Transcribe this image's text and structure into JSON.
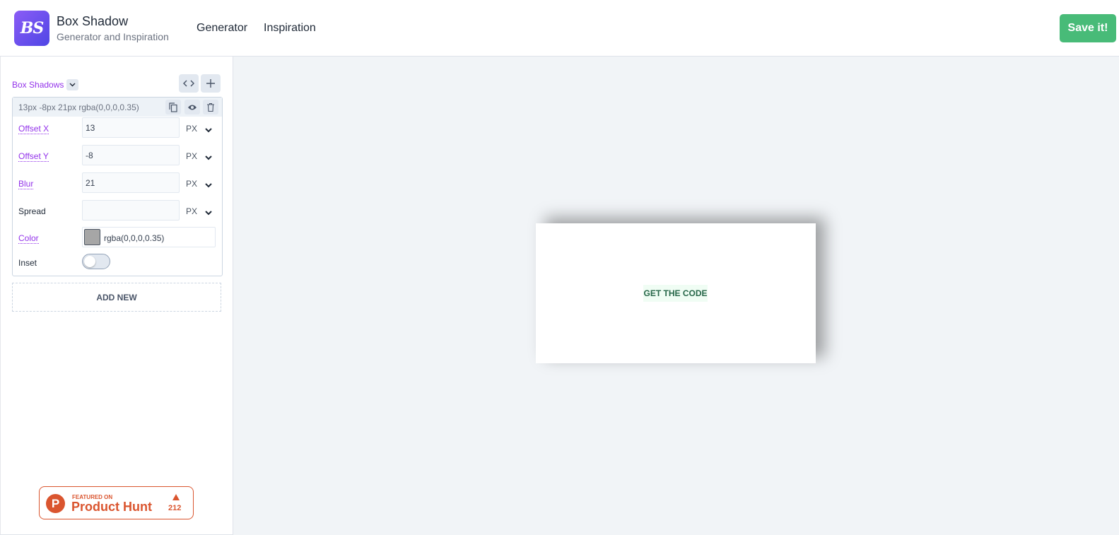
{
  "header": {
    "logo_text": "BS",
    "title": "Box Shadow",
    "subtitle": "Generator and Inspiration",
    "nav": [
      "Generator",
      "Inspiration"
    ],
    "save_label": "Save it!"
  },
  "sidebar": {
    "section_label": "Box Shadows",
    "shadow": {
      "summary": "13px -8px 21px rgba(0,0,0,0.35)",
      "rows": [
        {
          "label": "Offset X",
          "value": "13",
          "unit": "PX"
        },
        {
          "label": "Offset Y",
          "value": "-8",
          "unit": "PX"
        },
        {
          "label": "Blur",
          "value": "21",
          "unit": "PX"
        },
        {
          "label": "Spread",
          "value": "",
          "unit": "PX"
        }
      ],
      "color_label": "Color",
      "color_value": "rgba(0,0,0,0.35)",
      "inset_label": "Inset",
      "inset_on": false
    },
    "add_new_label": "ADD NEW",
    "product_hunt": {
      "featured": "FEATURED ON",
      "name": "Product Hunt",
      "count": "212"
    }
  },
  "canvas": {
    "button_label": "GET THE CODE"
  },
  "colors": {
    "accent": "#9333ea",
    "save": "#48bb78",
    "product_hunt": "#da552f",
    "canvas_bg": "#f1f4f7",
    "swatch": "#a6a6a6"
  }
}
